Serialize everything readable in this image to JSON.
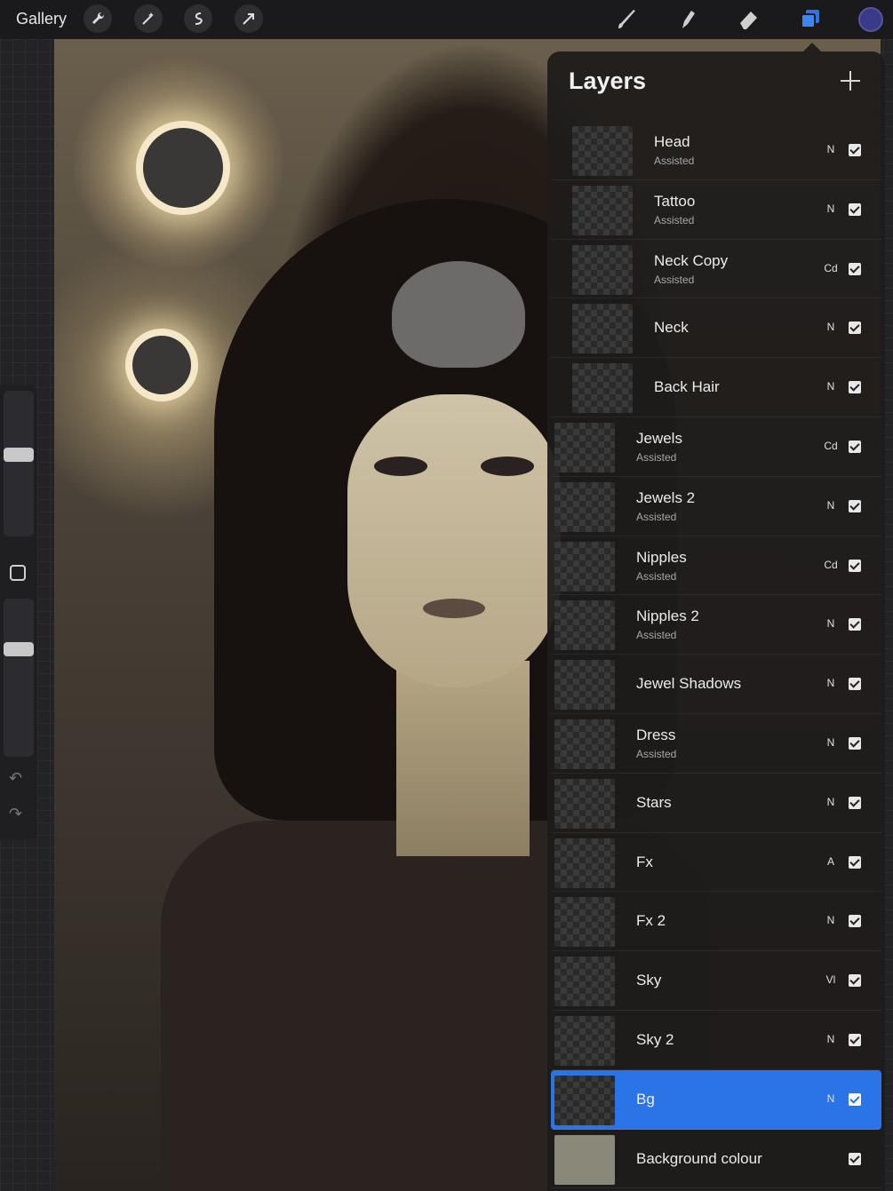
{
  "toolbar": {
    "gallery_label": "Gallery",
    "left_tools": [
      "wrench-icon",
      "magic-wand-icon",
      "selection-icon",
      "transform-arrow-icon"
    ],
    "right_tools": [
      "brush-icon",
      "smudge-icon",
      "eraser-icon",
      "layers-icon"
    ],
    "active_color": "#3a3a8a"
  },
  "layers_panel": {
    "title": "Layers",
    "add_icon": "plus-icon",
    "layers": [
      {
        "name": "Head",
        "sub": "Assisted",
        "blend": "N",
        "visible": true,
        "indent": true
      },
      {
        "name": "Tattoo",
        "sub": "Assisted",
        "blend": "N",
        "visible": true,
        "indent": true
      },
      {
        "name": "Neck Copy",
        "sub": "Assisted",
        "blend": "Cd",
        "visible": true,
        "indent": true
      },
      {
        "name": "Neck",
        "sub": "",
        "blend": "N",
        "visible": true,
        "indent": true
      },
      {
        "name": "Back Hair",
        "sub": "",
        "blend": "N",
        "visible": true,
        "indent": true
      },
      {
        "name": "Jewels",
        "sub": "Assisted",
        "blend": "Cd",
        "visible": true,
        "indent": false
      },
      {
        "name": "Jewels 2",
        "sub": "Assisted",
        "blend": "N",
        "visible": true,
        "indent": false
      },
      {
        "name": "Nipples",
        "sub": "Assisted",
        "blend": "Cd",
        "visible": true,
        "indent": false
      },
      {
        "name": "Nipples 2",
        "sub": "Assisted",
        "blend": "N",
        "visible": true,
        "indent": false
      },
      {
        "name": "Jewel Shadows",
        "sub": "",
        "blend": "N",
        "visible": true,
        "indent": false
      },
      {
        "name": "Dress",
        "sub": "Assisted",
        "blend": "N",
        "visible": true,
        "indent": false
      },
      {
        "name": "Stars",
        "sub": "",
        "blend": "N",
        "visible": true,
        "indent": false
      },
      {
        "name": "Fx",
        "sub": "",
        "blend": "A",
        "visible": true,
        "indent": false
      },
      {
        "name": "Fx 2",
        "sub": "",
        "blend": "N",
        "visible": true,
        "indent": false
      },
      {
        "name": "Sky",
        "sub": "",
        "blend": "Vl",
        "visible": true,
        "indent": false
      },
      {
        "name": "Sky 2",
        "sub": "",
        "blend": "N",
        "visible": true,
        "indent": false
      },
      {
        "name": "Bg",
        "sub": "",
        "blend": "N",
        "visible": true,
        "indent": false,
        "selected": true
      },
      {
        "name": "Background colour",
        "sub": "",
        "blend": "",
        "visible": true,
        "indent": false,
        "solid": "#8a8878"
      }
    ]
  },
  "sidebar": {
    "brush_size": 0.57,
    "opacity": 0.7,
    "undo_icon": "undo-icon",
    "redo_icon": "redo-icon"
  }
}
